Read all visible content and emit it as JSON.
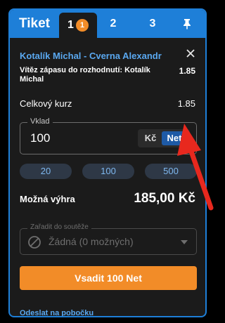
{
  "header": {
    "title": "Tiket",
    "tabs": [
      {
        "label": "1",
        "badge": "1",
        "active": true
      },
      {
        "label": "2",
        "active": false
      },
      {
        "label": "3",
        "active": false
      }
    ],
    "pin_icon": "pin-icon"
  },
  "bet": {
    "match": "Kotalík Michal - Cverna Alexandr",
    "description": "Vítěz zápasu do rozhodnutí: Kotalík Michal",
    "odds": "1.85",
    "close_icon": "close-icon"
  },
  "total": {
    "label": "Celkový kurz",
    "value": "1.85"
  },
  "stake": {
    "label": "Vklad",
    "value": "100",
    "units": [
      "Kč",
      "Net"
    ],
    "selected_unit": "Net"
  },
  "quick_stakes": [
    "20",
    "100",
    "500"
  ],
  "win": {
    "label": "Možná výhra",
    "value": "185,00 Kč"
  },
  "contest": {
    "label": "Zařadit do soutěže",
    "value": "Žádná (0 možných)",
    "disabled": true,
    "icon": "ban-icon"
  },
  "submit_label": "Vsadit 100 Net",
  "send_link": "Odeslat na pobočku",
  "colors": {
    "accent": "#1e7fd8",
    "panel": "#1b1b1b",
    "orange": "#f28c28",
    "link": "#5aa8f0",
    "annotation_arrow": "#e8281e"
  }
}
